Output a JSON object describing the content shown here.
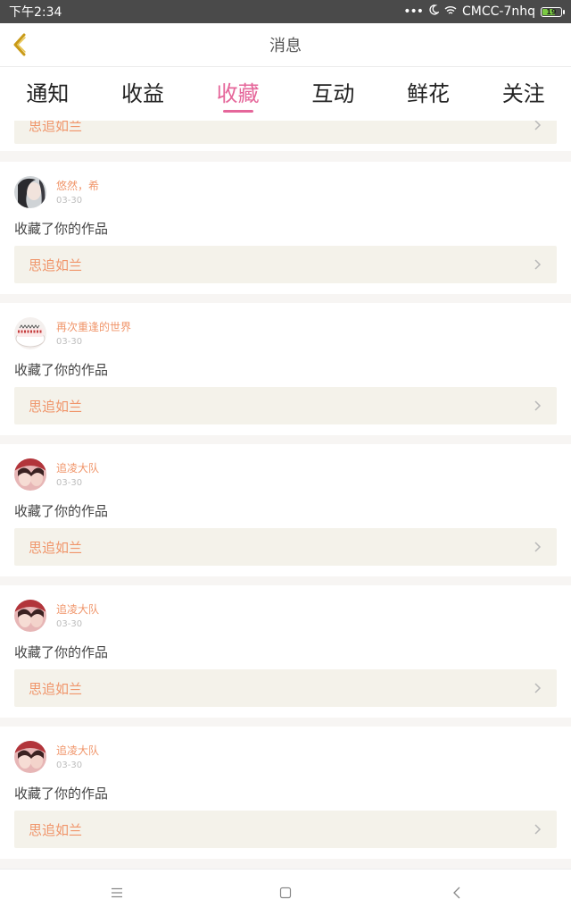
{
  "status_bar": {
    "time": "下午2:34",
    "carrier": "CMCC-7nhq",
    "battery": "19",
    "icons": [
      "more-dots-icon",
      "moon-icon",
      "wifi-icon",
      "battery-icon"
    ]
  },
  "nav": {
    "title": "消息",
    "back_icon": "chevron-left-icon"
  },
  "tabs": [
    {
      "label": "通知",
      "active": false
    },
    {
      "label": "收益",
      "active": false
    },
    {
      "label": "收藏",
      "active": true
    },
    {
      "label": "互动",
      "active": false
    },
    {
      "label": "鲜花",
      "active": false
    },
    {
      "label": "关注",
      "active": false
    }
  ],
  "partial_card": {
    "work_title": "思追如兰"
  },
  "cards": [
    {
      "user": "悠然，希",
      "date": "03-30",
      "action": "收藏了你的作品",
      "work_title": "思追如兰",
      "avatar": "avatar-girl-dark-hair"
    },
    {
      "user": "再次重逢的世界",
      "date": "03-30",
      "action": "收藏了你的作品",
      "work_title": "思追如兰",
      "avatar": "avatar-cake"
    },
    {
      "user": "追凌大队",
      "date": "03-30",
      "action": "收藏了你的作品",
      "work_title": "思追如兰",
      "avatar": "avatar-couple-pink"
    },
    {
      "user": "追凌大队",
      "date": "03-30",
      "action": "收藏了你的作品",
      "work_title": "思追如兰",
      "avatar": "avatar-couple-pink"
    },
    {
      "user": "追凌大队",
      "date": "03-30",
      "action": "收藏了你的作品",
      "work_title": "思追如兰",
      "avatar": "avatar-couple-pink"
    }
  ],
  "bottom_nav": [
    "menu-icon",
    "home-square-icon",
    "back-arrow-icon"
  ],
  "colors": {
    "accent": "#e5669a",
    "link": "#f0956a",
    "link_bg": "#f4f2ea"
  }
}
